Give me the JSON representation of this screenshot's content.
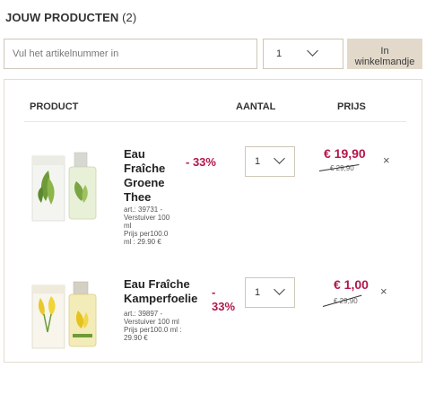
{
  "header": {
    "title": "JOUW PRODUCTEN",
    "count": "(2)"
  },
  "add_form": {
    "placeholder": "Vul het artikelnummer in",
    "quantity": "1",
    "button_label_line1": "In",
    "button_label_line2": "winkelmandje"
  },
  "table": {
    "col_product": "PRODUCT",
    "col_quantity": "AANTAL",
    "col_price": "PRIJS"
  },
  "items": [
    {
      "name_lines": [
        "Eau",
        "Fraîche",
        "Groene",
        "Thee"
      ],
      "discount_lines": [
        "- 33%"
      ],
      "meta_lines": [
        "art.: 39731 -",
        "Verstuiver 100",
        "ml",
        "Prijs per100.0",
        "ml : 29.90 €"
      ],
      "quantity": "1",
      "price_new": "€ 19,90",
      "price_old": "€ 29,90",
      "remove_symbol": "×"
    },
    {
      "name_lines": [
        "Eau Fraîche",
        "Kamperfoelie"
      ],
      "discount_lines": [
        "-",
        "33%"
      ],
      "meta_lines": [
        "art.: 39897 -",
        "Verstuiver 100 ml",
        "Prijs per100.0 ml :",
        "29.90 €"
      ],
      "quantity": "1",
      "price_new": "€ 1,00",
      "price_old": "€ 29,90",
      "remove_symbol": "×"
    }
  ],
  "colors": {
    "accent": "#b4174a",
    "button_bg": "#e2d9ca",
    "border": "#cfc7b6"
  },
  "icons": {
    "select_arrow": "chevron-down-icon",
    "remove": "close-icon"
  }
}
